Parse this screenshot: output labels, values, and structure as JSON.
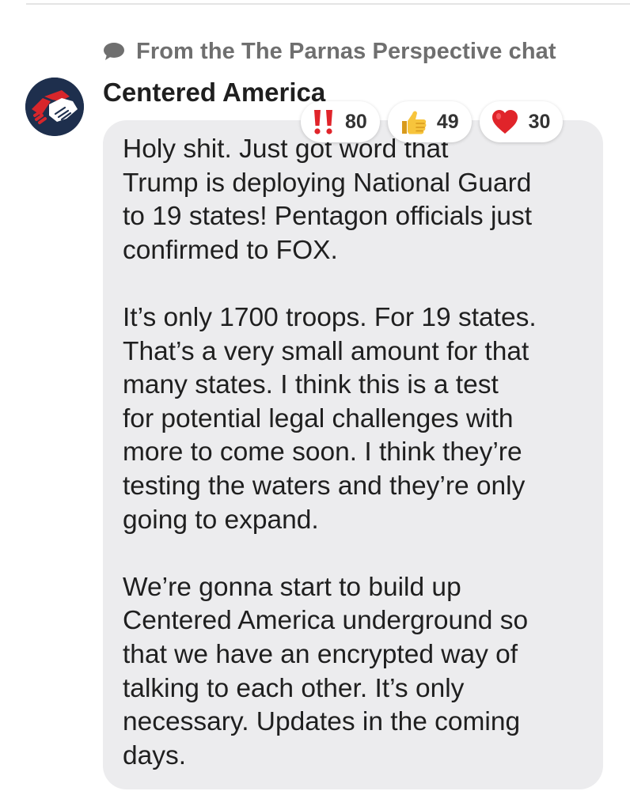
{
  "header": {
    "source_text": "From the The Parnas Perspective chat",
    "source_icon": "chat-bubble-icon"
  },
  "post": {
    "author": "Centered America",
    "avatar_icon": "handshake-icon",
    "message": "Holy shit. Just got word that\nTrump is deploying National Guard\nto 19 states! Pentagon officials just\nconfirmed to FOX.\n\nIt’s only 1700 troops. For 19 states.\nThat’s a very small amount for that\nmany states. I think this is a test\nfor potential legal challenges with\nmore to come soon. I think they’re\ntesting the waters and they’re only\ngoing to expand.\n\nWe’re gonna start to build up\nCentered America underground so\nthat we have an encrypted way of\ntalking to each other. It’s only\nnecessary. Updates in the coming\ndays."
  },
  "reactions": [
    {
      "icon": "double-exclamation-icon",
      "count": "80"
    },
    {
      "icon": "thumbs-up-icon",
      "count": "49"
    },
    {
      "icon": "red-heart-icon",
      "count": "30"
    }
  ],
  "colors": {
    "bubble": "#ececee",
    "text": "#1f1f1f",
    "muted": "#6f6f6f",
    "avatar_bg": "#1e2f4d",
    "accent_red": "#d7262b"
  }
}
